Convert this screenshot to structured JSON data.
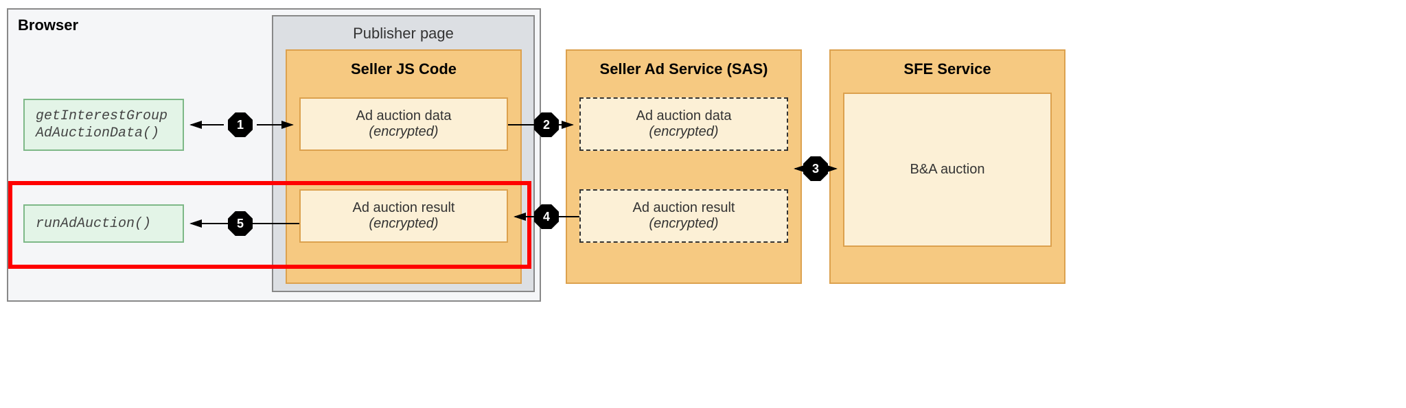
{
  "browser": {
    "title": "Browser"
  },
  "publisher": {
    "title": "Publisher page"
  },
  "sellerJs": {
    "title": "Seller JS Code"
  },
  "sas": {
    "title": "Seller Ad Service (SAS)"
  },
  "sfe": {
    "title": "SFE Service"
  },
  "api": {
    "getData": "getInterestGroup\nAdAuctionData()",
    "runAuction": "runAdAuction()"
  },
  "cards": {
    "data": {
      "line1": "Ad auction data",
      "line2": "(encrypted)"
    },
    "result": {
      "line1": "Ad auction result",
      "line2": "(encrypted)"
    },
    "ba": "B&A auction"
  },
  "steps": {
    "1": "1",
    "2": "2",
    "3": "3",
    "4": "4",
    "5": "5"
  }
}
